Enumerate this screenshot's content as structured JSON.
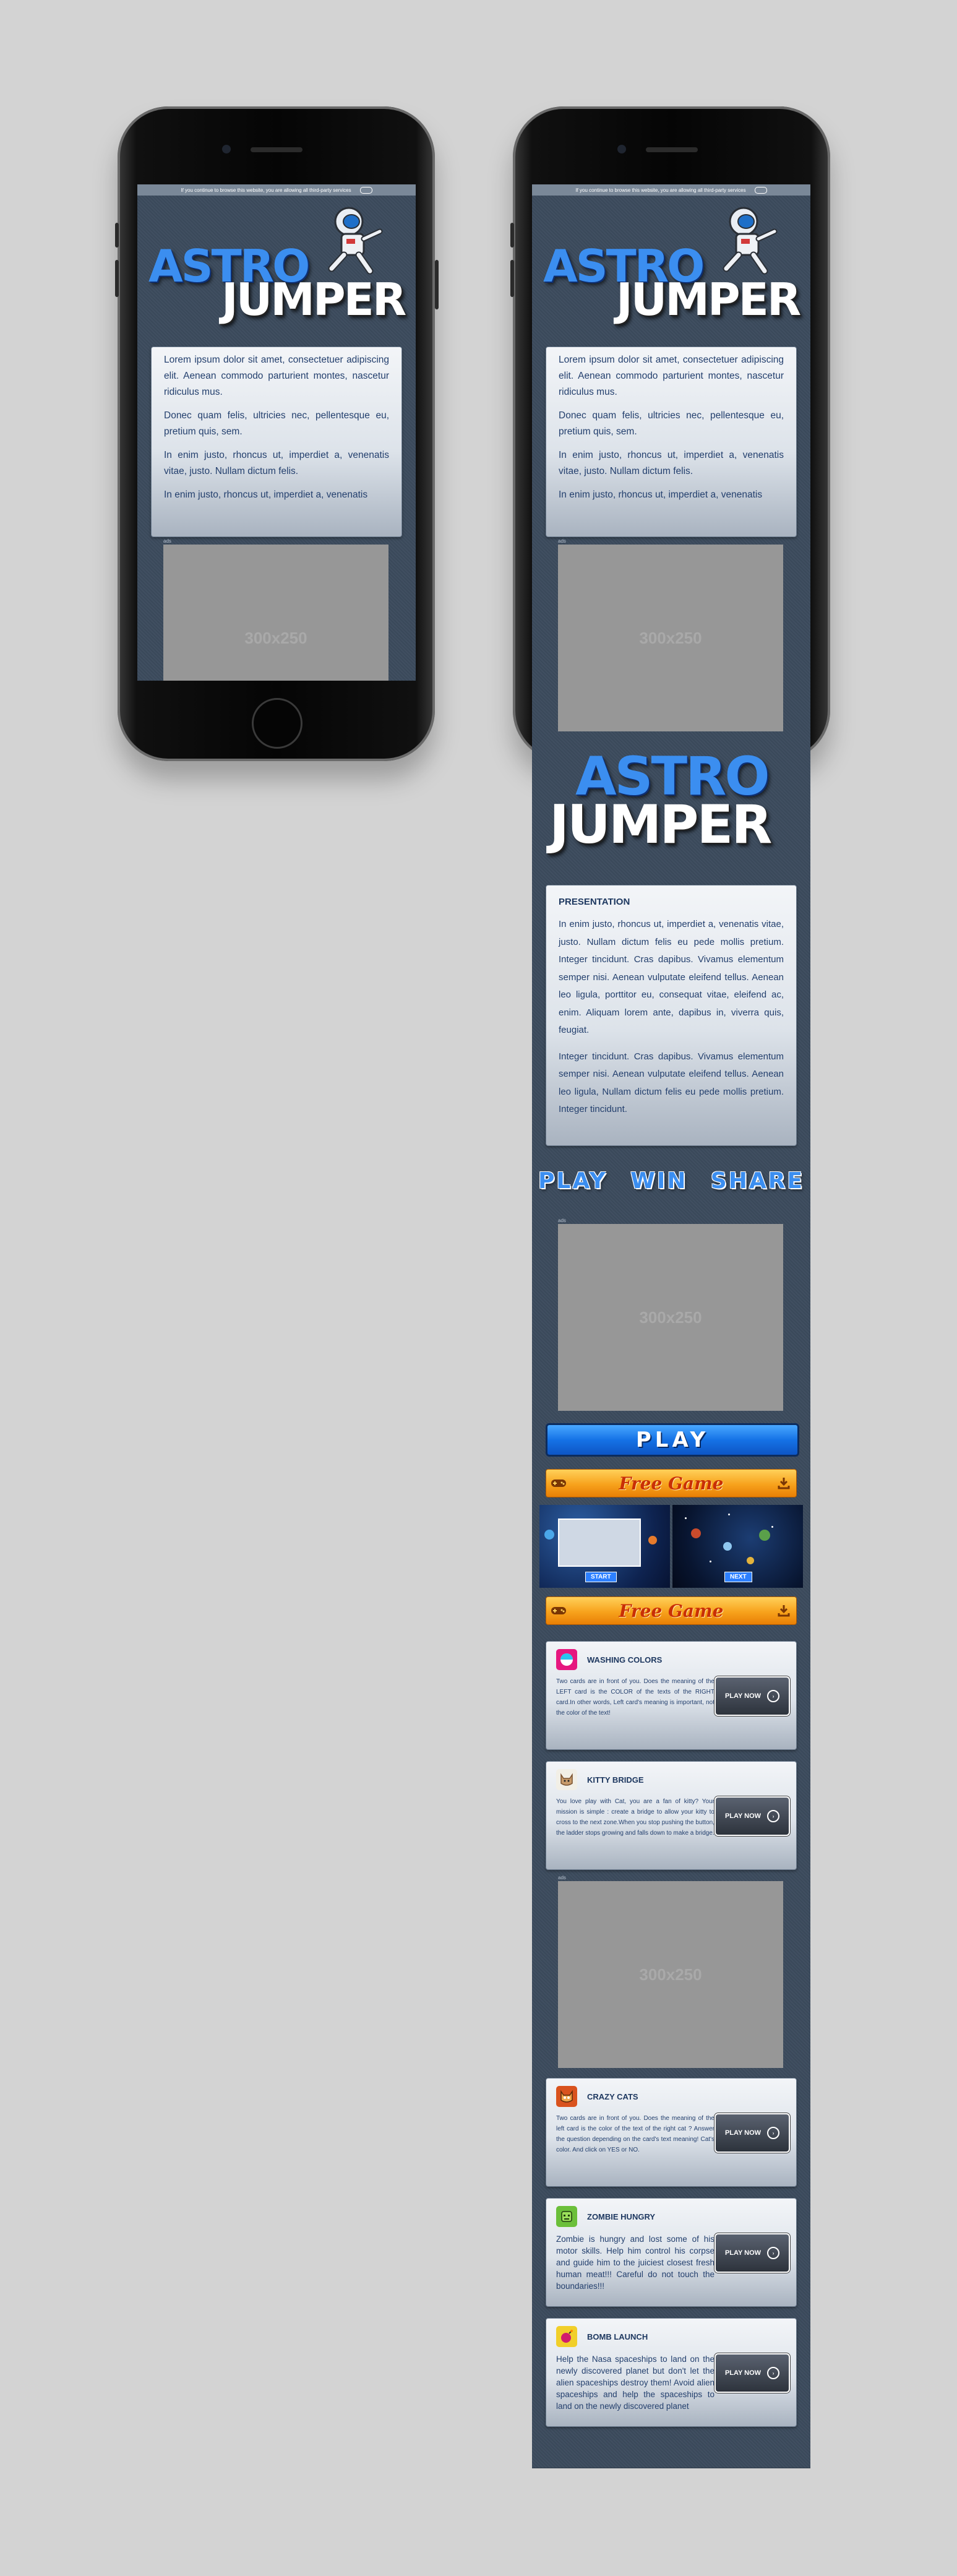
{
  "status_bar": {
    "text": "If you continue to browse this website, you are allowing all third-party services"
  },
  "logo": {
    "line1": "ASTRO",
    "line2": "JUMPER"
  },
  "intro": {
    "paragraphs": [
      "Lorem ipsum dolor sit amet, consectetuer adipiscing elit. Aenean commodo parturient montes, nascetur ridiculus mus.",
      "Donec quam felis, ultricies nec, pellentesque eu, pretium quis, sem.",
      "In enim justo, rhoncus ut, imperdiet a, venenatis vitae, justo. Nullam dictum felis.",
      "In enim justo, rhoncus ut, imperdiet a, venenatis"
    ]
  },
  "ads": {
    "label": "ads",
    "size": "300x250"
  },
  "presentation": {
    "title": "PRESENTATION",
    "p1": "In enim justo, rhoncus ut, imperdiet a, venenatis vitae, justo. Nullam dictum felis eu pede mollis pretium. Integer tincidunt. Cras dapibus. Vivamus elementum semper nisi. Aenean vulputate eleifend tellus. Aenean leo ligula, porttitor eu, consequat vitae, eleifend ac, enim. Aliquam lorem ante, dapibus in, viverra quis, feugiat.",
    "p2": "Integer tincidunt. Cras dapibus. Vivamus elementum semper nisi. Aenean vulputate eleifend tellus. Aenean leo ligula, Nullam dictum felis eu pede mollis pretium. Integer tincidunt."
  },
  "tagline": [
    "PLAY",
    "WIN",
    "SHARE"
  ],
  "play_label": "PLAY",
  "free_game_label": "Free Game",
  "screenshots": {
    "start_label": "START",
    "next_label": "NEXT"
  },
  "games": [
    {
      "title": "WASHING COLORS",
      "desc": "Two cards are in front of you. Does the meaning of the LEFT card is the COLOR of the texts of the RIGHT card.In other words, Left card's meaning is important, not the color of the text!",
      "button": "PLAY NOW",
      "icon": "color-wheel-icon",
      "icon_bg": "#e6177f",
      "icon_fg": "#ffffff"
    },
    {
      "title": "KITTY BRIDGE",
      "desc": "You love play with Cat, you are a fan of kitty? Your mission is simple : create a bridge to allow your kitty to cross to the next zone.When you stop pushing the button, the ladder stops growing and falls down to make a bridge.",
      "button": "PLAY NOW",
      "icon": "cat-icon",
      "icon_bg": "#f2efe6",
      "icon_fg": "#7a5230"
    },
    {
      "title": "CRAZY CATS",
      "desc": "Two cards are in front of you. Does the meaning of the left card is the color of the text of the right cat ? Answer the question depending on the card's text meaning! Cat's color. And click on YES or NO.",
      "button": "PLAY NOW",
      "icon": "crazy-cat-icon",
      "icon_bg": "#d9531e",
      "icon_fg": "#ffffff"
    },
    {
      "title": "ZOMBIE HUNGRY",
      "desc": "Zombie is hungry and lost some of his motor skills. Help him control his corpse and guide him to the juiciest closest fresh human meat!!! Careful do not touch the boundaries!!!",
      "button": "PLAY NOW",
      "icon": "zombie-icon",
      "icon_bg": "#6bbf3a",
      "icon_fg": "#1f3d0f"
    },
    {
      "title": "BOMB LAUNCH",
      "desc": "Help the Nasa spaceships to land on the newly discovered planet but don't let the alien spaceships destroy them! Avoid alien spaceships and help the spaceships to land on the newly discovered planet",
      "button": "PLAY NOW",
      "icon": "bomb-icon",
      "icon_bg": "#f1cf2a",
      "icon_fg": "#d11d6c"
    }
  ],
  "colors": {
    "page_bg": "#d3d3d3",
    "screen_bg": "#3c4b5d",
    "accent_blue": "#3b8ef0",
    "orange": "#f7a21c"
  }
}
